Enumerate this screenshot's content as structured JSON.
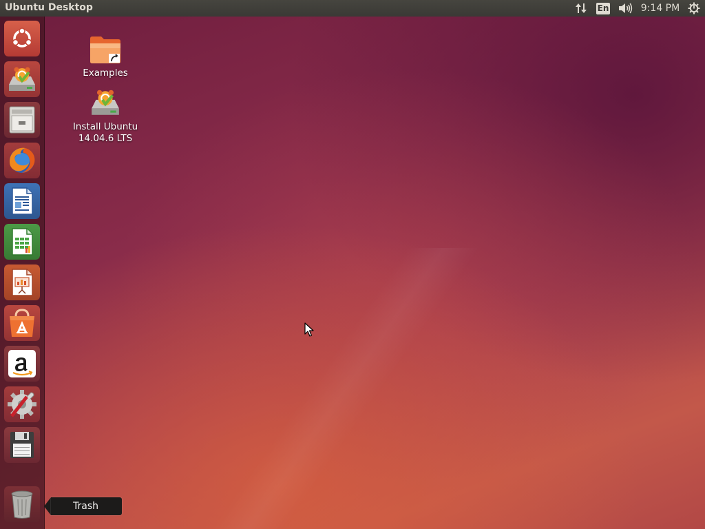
{
  "top_panel": {
    "title": "Ubuntu Desktop",
    "keyboard_layout": "En",
    "clock": "9:14 PM",
    "icons": {
      "network": "network-updown-icon",
      "sound": "volume-icon",
      "session": "power-gear-icon"
    }
  },
  "launcher": {
    "items": [
      {
        "name": "Search your computer",
        "icon": "ubuntu-dash-icon"
      },
      {
        "name": "Install Ubuntu",
        "icon": "installer-icon"
      },
      {
        "name": "Files",
        "icon": "file-cabinet-icon"
      },
      {
        "name": "Firefox Web Browser",
        "icon": "firefox-icon"
      },
      {
        "name": "LibreOffice Writer",
        "icon": "writer-icon"
      },
      {
        "name": "LibreOffice Calc",
        "icon": "calc-icon"
      },
      {
        "name": "LibreOffice Impress",
        "icon": "impress-icon"
      },
      {
        "name": "Ubuntu Software Center",
        "icon": "software-center-icon"
      },
      {
        "name": "Amazon",
        "icon": "amazon-icon"
      },
      {
        "name": "System Settings",
        "icon": "settings-icon"
      },
      {
        "name": "Disk",
        "icon": "floppy-disk-icon"
      },
      {
        "name": "Trash",
        "icon": "trash-icon"
      }
    ]
  },
  "desktop": {
    "icons": [
      {
        "label": "Examples",
        "icon": "folder-link-icon"
      },
      {
        "label_line1": "Install Ubuntu",
        "label_line2": "14.04.6 LTS",
        "icon": "installer-icon"
      }
    ]
  },
  "tooltip": {
    "text": "Trash"
  },
  "colors": {
    "panel": "#3c3b37",
    "ubuntu_orange": "#e95420",
    "launcher_bg": "#461622"
  }
}
